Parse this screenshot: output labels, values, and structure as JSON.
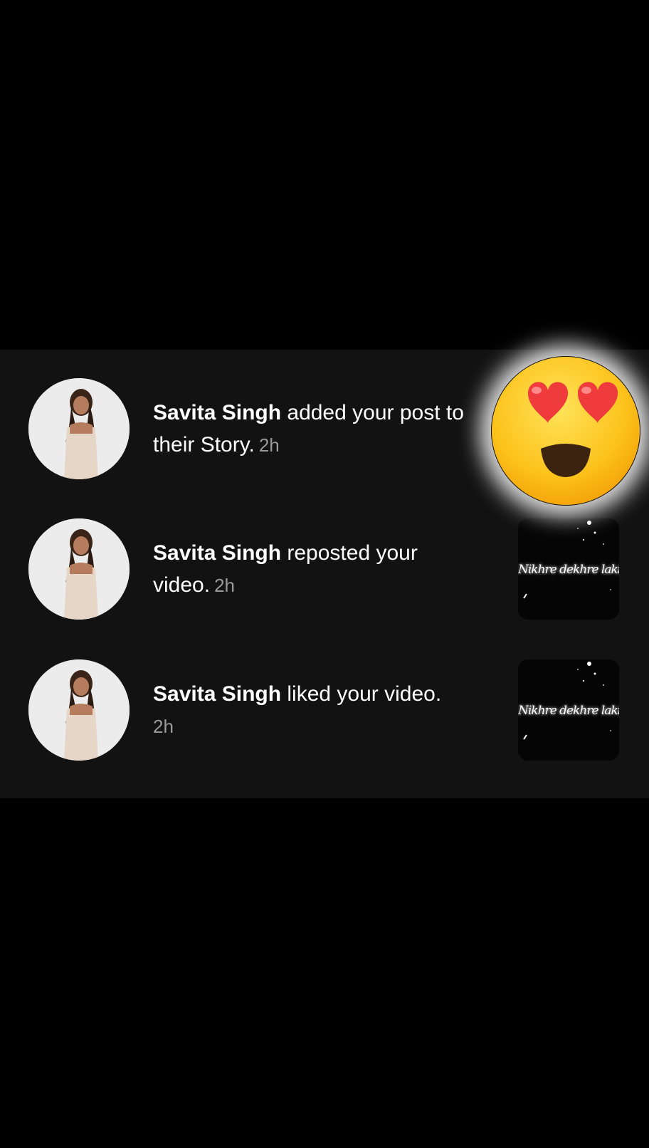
{
  "notifications": [
    {
      "user": "Savita Singh",
      "action": " added your post to their Story.",
      "time": "2h",
      "thumbnail": "heart-eyes-emoji"
    },
    {
      "user": "Savita Singh",
      "action": " reposted your video.",
      "time": "2h",
      "thumbnail": "video-thumbnail",
      "thumbnail_text": "Nikhre dekhre lakiyon ko"
    },
    {
      "user": "Savita Singh",
      "action": " liked your video.",
      "time": "2h",
      "thumbnail": "video-thumbnail",
      "thumbnail_text": "Nikhre dekhre lakiyon ko"
    }
  ],
  "colors": {
    "background": "#000000",
    "panel": "#121212",
    "text": "#ffffff",
    "timestamp": "#9a9a9a"
  }
}
